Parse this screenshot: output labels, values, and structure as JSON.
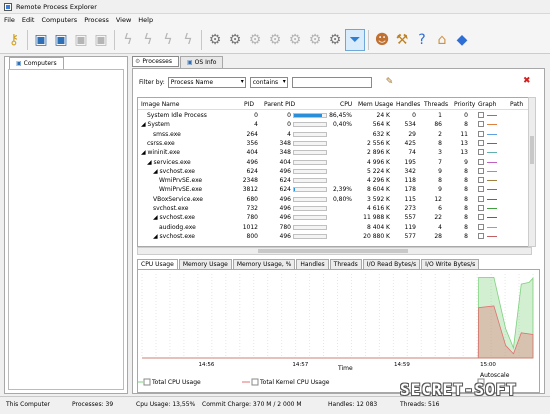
{
  "window": {
    "title": "Remote Process Explorer"
  },
  "menu": [
    "File",
    "Edit",
    "Computers",
    "Process",
    "View",
    "Help"
  ],
  "left_panel": {
    "tab_label": "Computers"
  },
  "right_tabs": [
    "Processes",
    "OS Info"
  ],
  "filter": {
    "label": "Filter by:",
    "field": "Process Name",
    "operator": "contains",
    "value": ""
  },
  "columns": [
    "Image Name",
    "PID",
    "Parent PID",
    "CPU",
    "Mem Usage",
    "Handles",
    "Threads",
    "Priority",
    "Graph",
    "Path"
  ],
  "rows": [
    {
      "name": "System Idle Process",
      "indent": 1,
      "pid": "0",
      "ppid": "0",
      "cpu": "86,45%",
      "cpu_frac": 0.86,
      "mem": "24 K",
      "handles": "0",
      "threads": "1",
      "priority": "0",
      "color": "#c06060"
    },
    {
      "name": "◢ System",
      "indent": 0,
      "pid": "4",
      "ppid": "0",
      "cpu": "0,40%",
      "cpu_frac": 0.01,
      "mem": "564 K",
      "handles": "534",
      "threads": "86",
      "priority": "8",
      "color": "#e08040"
    },
    {
      "name": "smss.exe",
      "indent": 2,
      "pid": "264",
      "ppid": "4",
      "cpu": "",
      "cpu_frac": 0,
      "mem": "632 K",
      "handles": "29",
      "threads": "2",
      "priority": "11",
      "color": "#60a0e0"
    },
    {
      "name": "csrss.exe",
      "indent": 1,
      "pid": "356",
      "ppid": "348",
      "cpu": "",
      "cpu_frac": 0,
      "mem": "2 556 K",
      "handles": "425",
      "threads": "8",
      "priority": "13",
      "color": "#6060c0"
    },
    {
      "name": "◢ wininit.exe",
      "indent": 0,
      "pid": "404",
      "ppid": "348",
      "cpu": "",
      "cpu_frac": 0,
      "mem": "2 896 K",
      "handles": "74",
      "threads": "3",
      "priority": "13",
      "color": "#60b0b0"
    },
    {
      "name": "◢ services.exe",
      "indent": 1,
      "pid": "496",
      "ppid": "404",
      "cpu": "",
      "cpu_frac": 0,
      "mem": "4 996 K",
      "handles": "195",
      "threads": "7",
      "priority": "9",
      "color": "#c060c0"
    },
    {
      "name": "◢ svchost.exe",
      "indent": 2,
      "pid": "624",
      "ppid": "496",
      "cpu": "",
      "cpu_frac": 0,
      "mem": "5 224 K",
      "handles": "342",
      "threads": "9",
      "priority": "8",
      "color": "#60c060"
    },
    {
      "name": "WmiPrvSE.exe",
      "indent": 3,
      "pid": "2348",
      "ppid": "624",
      "cpu": "",
      "cpu_frac": 0,
      "mem": "4 296 K",
      "handles": "118",
      "threads": "8",
      "priority": "8",
      "color": "#a08040"
    },
    {
      "name": "WmiPrvSE.exe",
      "indent": 3,
      "pid": "3812",
      "ppid": "624",
      "cpu": "2,39%",
      "cpu_frac": 0.03,
      "mem": "8 604 K",
      "handles": "178",
      "threads": "9",
      "priority": "8",
      "color": "#4080c0"
    },
    {
      "name": "VBoxService.exe",
      "indent": 2,
      "pid": "680",
      "ppid": "496",
      "cpu": "0,80%",
      "cpu_frac": 0.01,
      "mem": "3 592 K",
      "handles": "115",
      "threads": "12",
      "priority": "8",
      "color": "#c04040"
    },
    {
      "name": "svchost.exe",
      "indent": 2,
      "pid": "732",
      "ppid": "496",
      "cpu": "",
      "cpu_frac": 0,
      "mem": "4 616 K",
      "handles": "273",
      "threads": "6",
      "priority": "8",
      "color": "#40a040"
    },
    {
      "name": "◢ svchost.exe",
      "indent": 2,
      "pid": "780",
      "ppid": "496",
      "cpu": "",
      "cpu_frac": 0,
      "mem": "11 988 K",
      "handles": "557",
      "threads": "22",
      "priority": "8",
      "color": "#8040c0"
    },
    {
      "name": "audiodg.exe",
      "indent": 3,
      "pid": "1012",
      "ppid": "780",
      "cpu": "",
      "cpu_frac": 0,
      "mem": "8 404 K",
      "handles": "119",
      "threads": "4",
      "priority": "8",
      "color": "#c0a040"
    },
    {
      "name": "◢ svchost.exe",
      "indent": 2,
      "pid": "800",
      "ppid": "496",
      "cpu": "",
      "cpu_frac": 0,
      "mem": "20 880 K",
      "handles": "577",
      "threads": "28",
      "priority": "8",
      "color": "#c06060"
    }
  ],
  "bottom_tabs": [
    "CPU Usage",
    "Memory Usage",
    "Memory Usage, %",
    "Handles",
    "Threads",
    "I/O Read Bytes/s",
    "I/O Write Bytes/s"
  ],
  "chart_data": {
    "type": "area",
    "x_ticks": [
      "14:56",
      "14:57",
      "14:59",
      "15:00"
    ],
    "xlabel": "Time",
    "series": [
      {
        "name": "Total CPU Usage",
        "color": "#7ed07e",
        "points": [
          [
            0.0,
            0.0
          ],
          [
            0.86,
            0.0
          ],
          [
            0.861,
            0.96
          ],
          [
            0.9,
            0.96
          ],
          [
            0.93,
            0.35
          ],
          [
            0.95,
            0.12
          ],
          [
            0.97,
            0.88
          ],
          [
            0.99,
            0.9
          ],
          [
            1.0,
            0.95
          ]
        ]
      },
      {
        "name": "Total Kernel CPU Usage",
        "color": "#e07070",
        "points": [
          [
            0.0,
            0.0
          ],
          [
            0.86,
            0.0
          ],
          [
            0.861,
            0.6
          ],
          [
            0.9,
            0.62
          ],
          [
            0.93,
            0.15
          ],
          [
            0.95,
            0.05
          ],
          [
            0.97,
            0.3
          ],
          [
            1.0,
            0.28
          ]
        ]
      }
    ],
    "legend_position": "bottom"
  },
  "legend": {
    "total_cpu": "Total CPU Usage",
    "total_kernel": "Total Kernel CPU Usage",
    "autoscale": "Autoscale"
  },
  "status": {
    "computer": "This Computer",
    "processes": "Processes: 39",
    "cpu": "Cpu Usage: 13,55%",
    "commit": "Commit Charge: 370 M / 2 000 M",
    "handles": "Handles: 12 083",
    "threads": "Threads: 516"
  },
  "watermark": "SECRET-SOFT",
  "icons": [
    "key-icon",
    "computer-add-icon",
    "computer-remove-icon",
    "disabled-icon",
    "lightning-icon",
    "gear-icon",
    "filter-icon",
    "users-icon",
    "wrench-icon",
    "help-icon",
    "home-icon",
    "diamond-icon"
  ]
}
